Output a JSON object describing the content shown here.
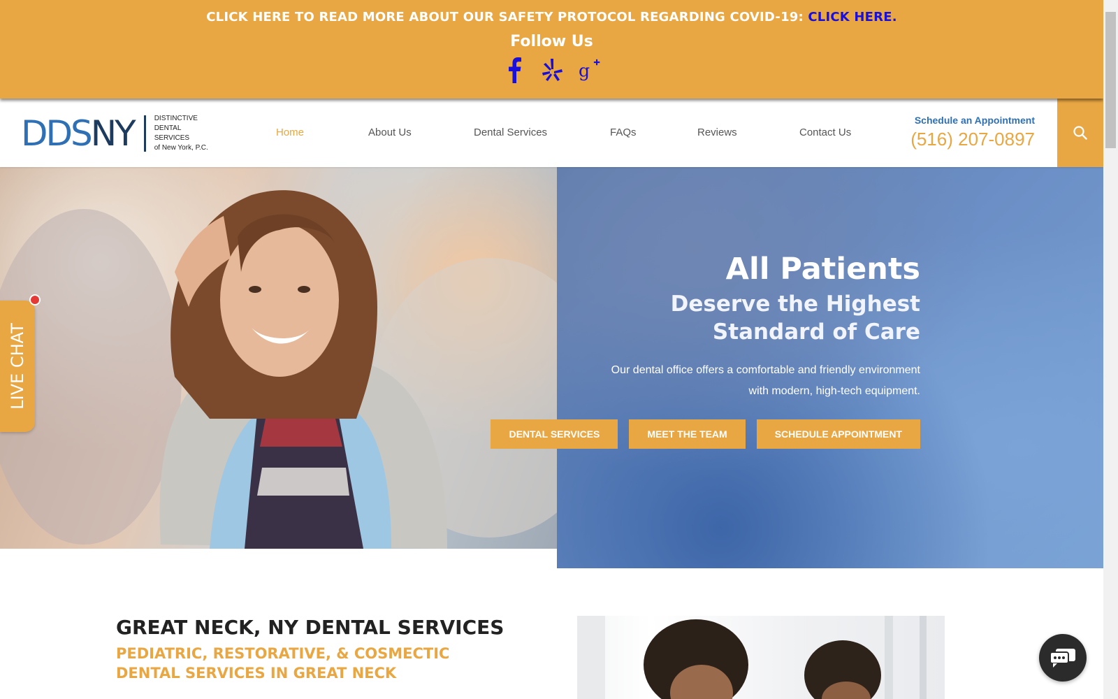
{
  "banner": {
    "covid_text": "CLICK HERE TO READ MORE ABOUT OUR SAFETY PROTOCOL REGARDING COVID-19: ",
    "covid_link": "CLICK HERE.",
    "follow_us": "Follow Us",
    "social_icons": [
      "facebook-icon",
      "yelp-icon",
      "google-plus-icon"
    ]
  },
  "header": {
    "logo": {
      "dds": "DDS",
      "ny": "NY",
      "sub": [
        "DISTINCTIVE",
        "DENTAL",
        "SERVICES",
        "of New York, P.C."
      ]
    },
    "nav": [
      "Home",
      "About Us",
      "Dental Services",
      "FAQs",
      "Reviews",
      "Contact Us"
    ],
    "active_nav": "Home",
    "appointment_label": "Schedule an Appointment",
    "phone": "(516) 207-0897"
  },
  "hero": {
    "title": "All Patients",
    "subtitle_1": "Deserve the Highest",
    "subtitle_2": "Standard of Care",
    "text_1": "Our dental office offers a comfortable and friendly environment",
    "text_2": "with modern, high-tech equipment.",
    "buttons": [
      "DENTAL SERVICES",
      "MEET THE TEAM",
      "SCHEDULE APPOINTMENT"
    ]
  },
  "live_chat": "LIVE CHAT",
  "section": {
    "title": "GREAT NECK, NY DENTAL SERVICES",
    "subtitle_1": "PEDIATRIC, RESTORATIVE, & COSMECTIC",
    "subtitle_2": "DENTAL SERVICES IN GREAT NECK"
  },
  "colors": {
    "accent": "#e9a743",
    "brand_blue": "#2f6fb4",
    "link_blue": "#1a0fd6",
    "dark_text": "#222222"
  }
}
